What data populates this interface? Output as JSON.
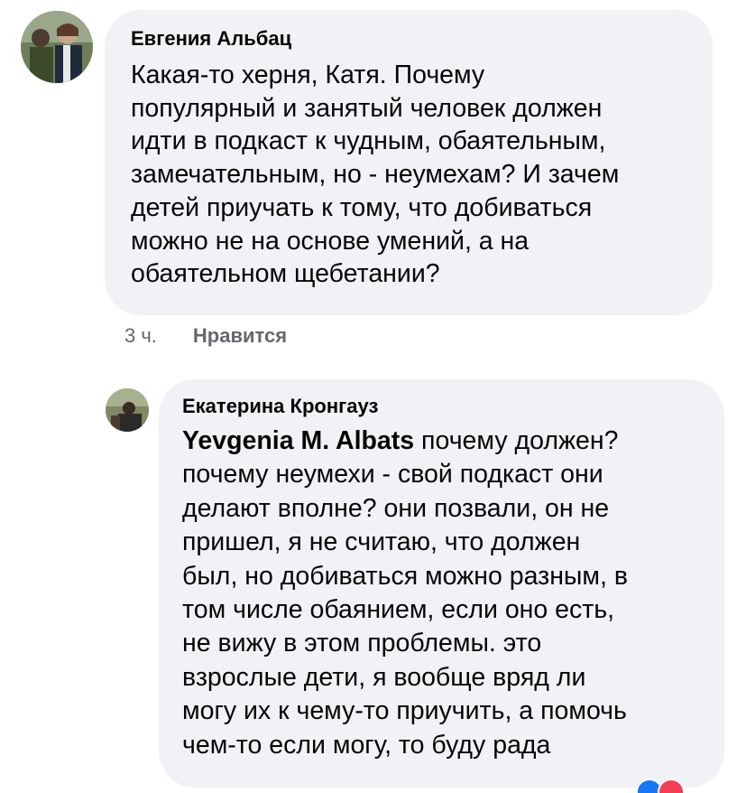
{
  "comments": [
    {
      "author": "Евгения Альбац",
      "text": "Какая-то херня, Катя. Почему\nпопулярный и занятый человек должен\nидти в подкаст к чудным, обаятельным,\nзамечательным, но - неумехам? И зачем\nдетей приучать к тому, что добиваться\nможно не на основе умений, а на\nобаятельном щебетании?",
      "time": "3 ч.",
      "like_label": "Нравится",
      "avatar_icon": "profile-photo"
    },
    {
      "author": "Екатерина Кронгауз",
      "mention": "Yevgenia M. Albats",
      "text_first_line": " почему должен?",
      "text": "почему неумехи - свой подкаст они\nделают вполне? они позвали, он не\nпришел, я не считаю, что должен\nбыл, но добиваться можно разным, в\nтом числе обаянием, если оно есть,\nне вижу в этом проблемы. это\nвзрослые дети, я вообще вряд ли\nмогу их к чему-то приучить, а помочь\nчем-то если могу, то буду рада",
      "avatar_icon": "profile-photo"
    }
  ],
  "colors": {
    "bubble_bg": "#f0f2f5",
    "text": "#050505",
    "secondary": "#65676b",
    "like_reaction": "#1877f2",
    "love_reaction": "#f33e58"
  }
}
